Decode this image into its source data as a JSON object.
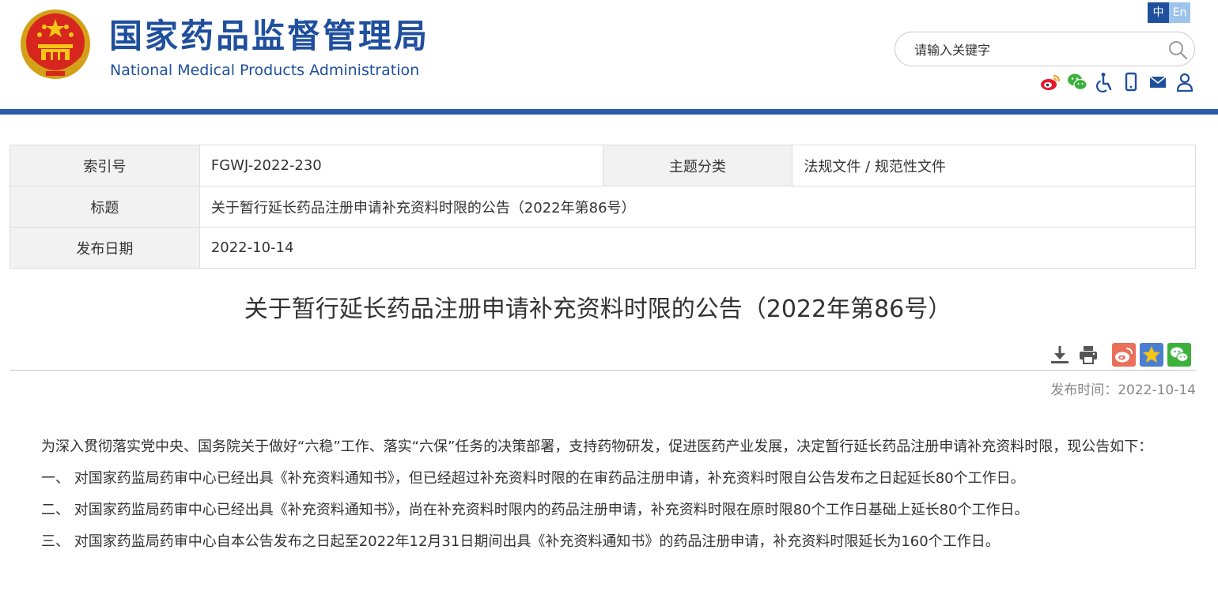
{
  "header": {
    "logo_cn": "国家药品监督管理局",
    "logo_en": "National Medical Products Administration",
    "lang_zh": "中",
    "lang_en": "En",
    "search_placeholder": "请输入关键字",
    "icons": [
      "weibo-icon",
      "wechat-icon",
      "accessibility-icon",
      "mobile-icon",
      "mail-icon",
      "user-icon"
    ]
  },
  "info": {
    "index_label": "索引号",
    "index_value": "FGWJ-2022-230",
    "category_label": "主题分类",
    "category_value": "法规文件 / 规范性文件",
    "title_label": "标题",
    "title_value": "关于暂行延长药品注册申请补充资料时限的公告（2022年第86号）",
    "date_label": "发布日期",
    "date_value": "2022-10-14"
  },
  "article": {
    "title": "关于暂行延长药品注册申请补充资料时限的公告（2022年第86号）",
    "pub_label": "发布时间：",
    "pub_date": "2022-10-14",
    "paragraphs": [
      "为深入贯彻落实党中央、国务院关于做好“六稳”工作、落实“六保”任务的决策部署，支持药物研发，促进医药产业发展，决定暂行延长药品注册申请补充资料时限，现公告如下：",
      "一、 对国家药监局药审中心已经出具《补充资料通知书》，但已经超过补充资料时限的在审药品注册申请，补充资料时限自公告发布之日起延长80个工作日。",
      "二、 对国家药监局药审中心已经出具《补充资料通知书》，尚在补充资料时限内的药品注册申请，补充资料时限在原时限80个工作日基础上延长80个工作日。",
      "三、 对国家药监局药审中心自本公告发布之日起至2022年12月31日期间出具《补充资料通知书》的药品注册申请，补充资料时限延长为160个工作日。"
    ]
  },
  "colors": {
    "brand_blue": "#1f4f9d",
    "header_bar": "#2a5caa",
    "label_bg": "#f2f2f2",
    "weibo_red": "#e6162d",
    "wechat_green": "#3bb13b"
  }
}
